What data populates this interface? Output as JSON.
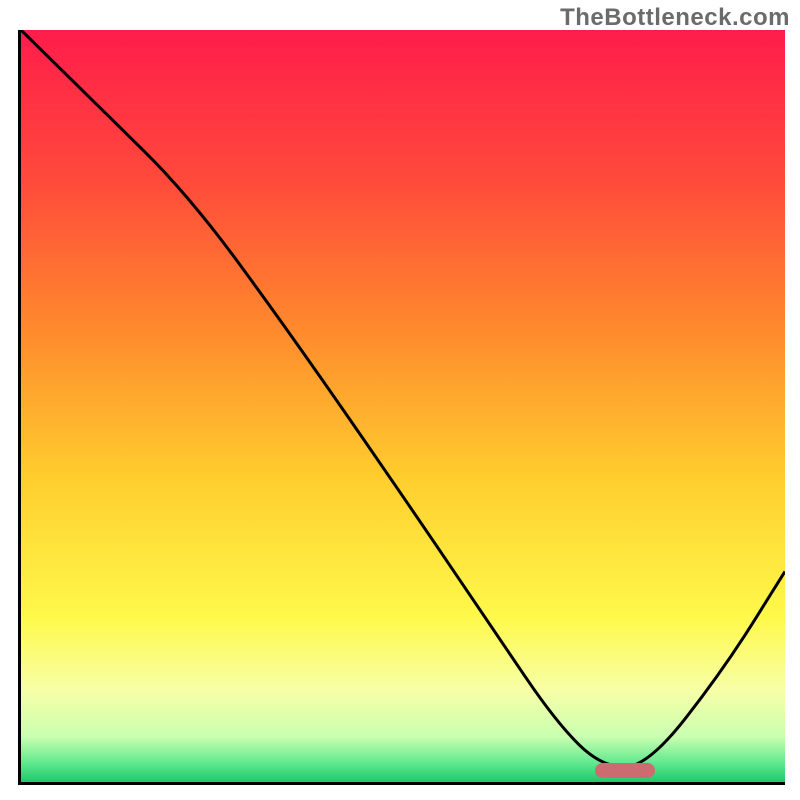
{
  "watermark": "TheBottleneck.com",
  "chart_data": {
    "type": "line",
    "title": "",
    "xlabel": "",
    "ylabel": "",
    "xlim": [
      0,
      100
    ],
    "ylim": [
      0,
      100
    ],
    "grid": false,
    "legend": false,
    "background_gradient_stops": [
      {
        "offset": 0.0,
        "color": "#ff1c4b"
      },
      {
        "offset": 0.2,
        "color": "#ff4a3b"
      },
      {
        "offset": 0.4,
        "color": "#ff8a2d"
      },
      {
        "offset": 0.6,
        "color": "#ffcf2e"
      },
      {
        "offset": 0.78,
        "color": "#fff94a"
      },
      {
        "offset": 0.88,
        "color": "#f7ffa8"
      },
      {
        "offset": 0.94,
        "color": "#c8ffb0"
      },
      {
        "offset": 0.975,
        "color": "#5fe88f"
      },
      {
        "offset": 1.0,
        "color": "#1fc86a"
      }
    ],
    "series": [
      {
        "name": "bottleneck-curve",
        "x": [
          0,
          10,
          22,
          35,
          50,
          62,
          70,
          76,
          82,
          92,
          100
        ],
        "y": [
          100,
          90,
          78,
          60,
          38,
          20,
          8,
          2,
          2,
          15,
          28
        ]
      }
    ],
    "marker": {
      "name": "optimal-range",
      "x_center": 79,
      "y": 1.5,
      "color": "#cc6b70"
    }
  }
}
